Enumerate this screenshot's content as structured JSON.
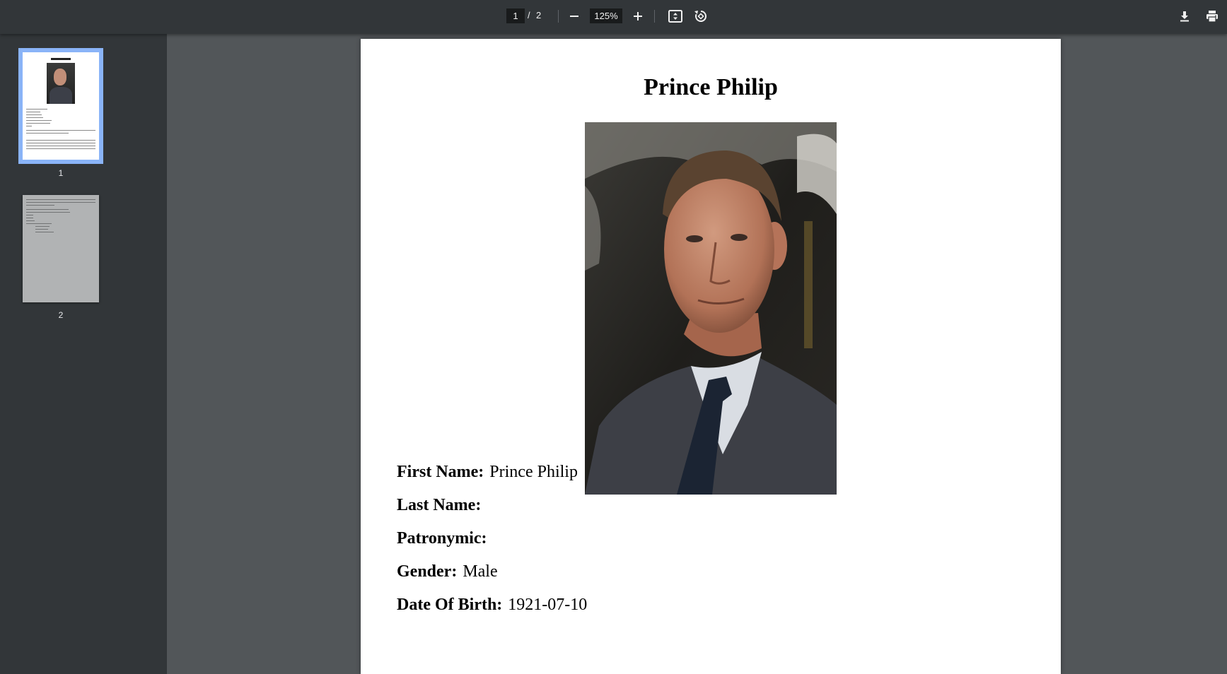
{
  "toolbar": {
    "current_page": "1",
    "separator": "/",
    "total_pages": "2",
    "zoom": "125%"
  },
  "sidebar": {
    "thumbnails": [
      {
        "label": "1",
        "active": true
      },
      {
        "label": "2",
        "active": false
      }
    ]
  },
  "document": {
    "title": "Prince Philip",
    "fields": [
      {
        "label": "First Name:",
        "value": "Prince Philip"
      },
      {
        "label": "Last Name:",
        "value": ""
      },
      {
        "label": "Patronymic:",
        "value": ""
      },
      {
        "label": "Gender:",
        "value": "Male"
      },
      {
        "label": "Date Of Birth:",
        "value": "1921-07-10"
      }
    ]
  },
  "colors": {
    "toolbar_bg": "#323639",
    "viewer_bg": "#525659",
    "active_thumb_outline": "#8ab4f8"
  },
  "icons": [
    "minus-icon",
    "plus-icon",
    "fit-page-icon",
    "rotate-icon",
    "download-icon",
    "print-icon"
  ]
}
